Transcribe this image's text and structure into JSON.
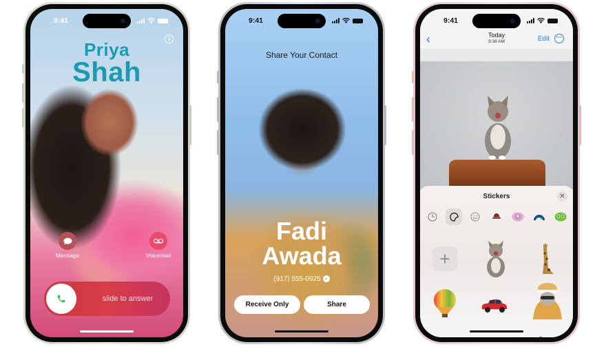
{
  "status_bar": {
    "time": "9:41"
  },
  "incoming_call": {
    "first_name": "Priya",
    "last_name": "Shah",
    "name_color": "#1a9bb2",
    "info_icon": "info-icon",
    "actions": [
      {
        "label": "Message",
        "icon": "message-bubble-icon"
      },
      {
        "label": "Voicemail",
        "icon": "voicemail-icon"
      }
    ],
    "slider_label": "slide to answer",
    "answer_icon": "phone-icon",
    "answer_color": "#2fbf4a"
  },
  "share_contact": {
    "title": "Share Your Contact",
    "first_name": "Fadi",
    "last_name": "Awada",
    "phone_number": "(917) 555-0925",
    "buttons": {
      "receive_only": "Receive Only",
      "share": "Share"
    }
  },
  "messages": {
    "nav": {
      "title": "Today",
      "subtitle": "9:38 AM",
      "edit": "Edit",
      "back_icon": "chevron-left-icon",
      "more_icon": "ellipsis-circle-icon",
      "accent": "#2c7ef4"
    },
    "stickers": {
      "title": "Stickers",
      "categories": [
        {
          "name": "recents",
          "icon": "clock-icon"
        },
        {
          "name": "stickers",
          "icon": "sticker-peel-icon",
          "selected": true
        },
        {
          "name": "emoji",
          "icon": "smiley-icon"
        },
        {
          "name": "pack-1",
          "icon": "character-sticker-icon"
        },
        {
          "name": "pack-2",
          "icon": "pink-character-icon"
        },
        {
          "name": "pack-3",
          "icon": "landscape-sticker-icon"
        },
        {
          "name": "pack-4",
          "icon": "green-bird-icon"
        },
        {
          "name": "pack-5",
          "icon": "red-sticker-icon"
        }
      ],
      "items": [
        {
          "name": "add-sticker",
          "label": "+"
        },
        {
          "name": "kitten"
        },
        {
          "name": "giraffe"
        },
        {
          "name": "hot-air-balloon"
        },
        {
          "name": "red-car"
        },
        {
          "name": "cat-in-hat"
        }
      ]
    }
  }
}
